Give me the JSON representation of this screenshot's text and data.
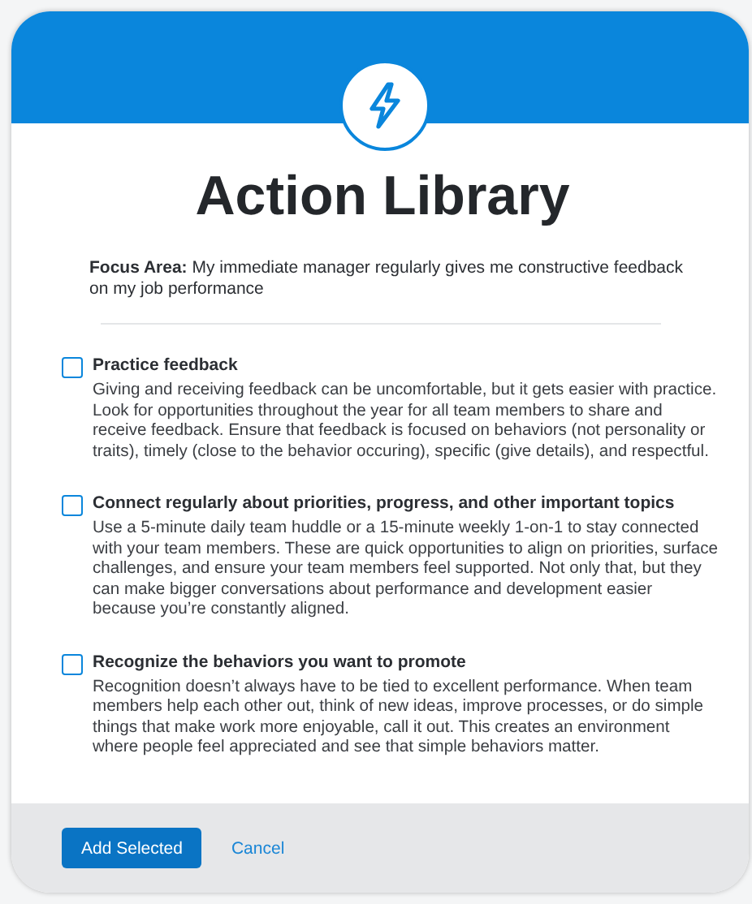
{
  "dialog": {
    "title": "Action Library",
    "focus_area": {
      "label": "Focus Area:",
      "text": "My immediate manager regularly gives me constructive feedback on my job performance"
    }
  },
  "actions": [
    {
      "title": "Practice feedback",
      "checked": false,
      "description": "Giving and receiving feedback can be uncomfortable, but it gets easier with practice. Look for opportunities throughout the year for all team members to share and receive feedback. Ensure that feedback is focused on behaviors (not personality or traits), timely (close to the behavior occuring), specific (give details), and respectful."
    },
    {
      "title": "Connect regularly about priorities, progress, and other important topics",
      "checked": false,
      "description": "Use a 5-minute daily team huddle or a 15-minute weekly 1-on-1 to stay connected with your team members. These are quick opportunities to align on priorities, surface challenges, and ensure your team members feel supported. Not only that, but they can make bigger conversations about performance and development easier because you’re constantly aligned."
    },
    {
      "title": "Recognize the behaviors you want to promote",
      "checked": false,
      "description": "Recognition doesn’t always have to be tied to excellent performance. When team members help each other out, think of new ideas, improve processes, or do simple things that make work more enjoyable, call it out. This creates an environment where people feel appreciated and see that simple behaviors matter."
    }
  ],
  "buttons": [
    {
      "label": "Add Selected",
      "kind": "primary"
    },
    {
      "label": "Cancel",
      "kind": "link"
    }
  ]
}
